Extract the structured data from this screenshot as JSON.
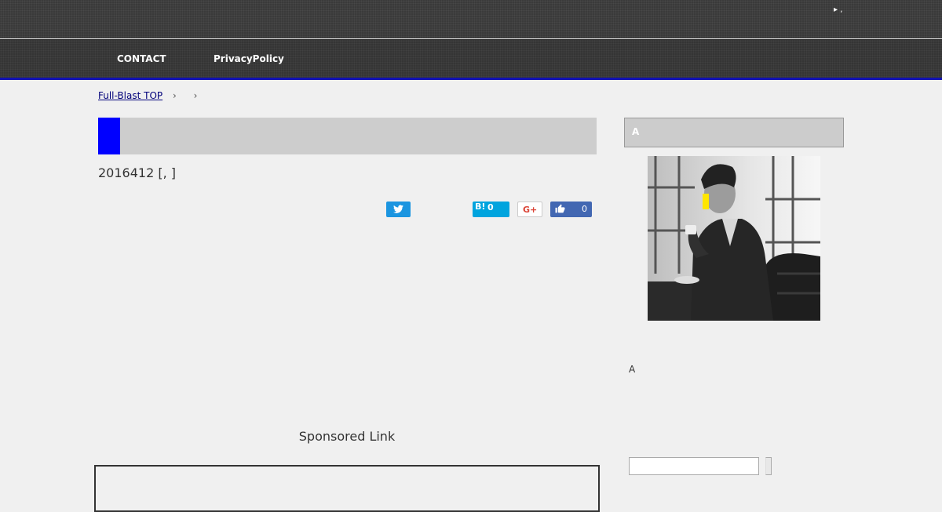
{
  "header": {
    "top_link": "▸ ,"
  },
  "nav": {
    "items": [
      {
        "label": "CONTACT"
      },
      {
        "label": "PrivacyPolicy"
      }
    ]
  },
  "breadcrumb": {
    "home": "Full-Blast TOP",
    "sep": "›"
  },
  "post": {
    "meta_date": "2016412",
    "meta_open": " [",
    "meta_link": ",",
    "meta_close": " ]"
  },
  "share": {
    "hatena_label": "B!",
    "hatena_count": "0",
    "gplus_label": "G+",
    "fb_count": "0"
  },
  "content": {
    "sponsored": "Sponsored Link"
  },
  "sidebar": {
    "profile_heading": "A",
    "profile_text": "A",
    "search": {
      "placeholder": ""
    }
  },
  "colors": {
    "accent": "#0000ff",
    "nav_border": "#1212b3",
    "twitter": "#1b95e0",
    "hatena": "#00a4de",
    "facebook": "#4267b2"
  }
}
